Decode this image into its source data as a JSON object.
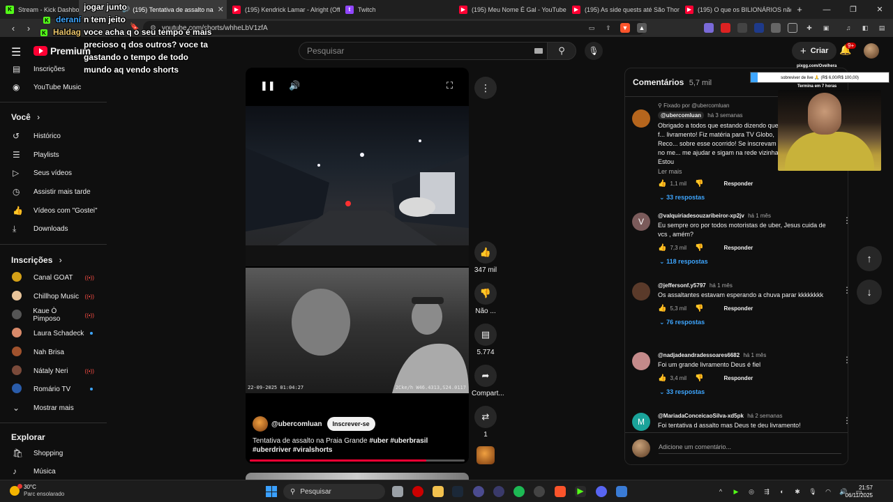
{
  "browser": {
    "tabs": [
      {
        "label": "Stream - Kick Dashboard",
        "favicon": "kick-icon",
        "active": false
      },
      {
        "label": "(195) Tentativa de assalto na",
        "favicon": "youtube-icon",
        "active": true
      },
      {
        "label": "(195) Kendrick Lamar - Alright (Offic",
        "favicon": "youtube-icon",
        "active": false
      },
      {
        "label": "Twitch",
        "favicon": "twitch-icon",
        "active": false
      },
      {
        "label": "(195) Meu Nome É Gal - YouTube",
        "favicon": "youtube-icon",
        "active": false
      },
      {
        "label": "(195) As side quests até São Thomé",
        "favicon": "youtube-icon",
        "active": false
      },
      {
        "label": "(195) O que os BILIONÁRIOS não te",
        "favicon": "youtube-icon",
        "active": false
      }
    ],
    "url": "youtube.com/shorts/whheLbV1zfA"
  },
  "youtube": {
    "logo_label": "Premium",
    "search_placeholder": "Pesquisar",
    "create_label": "Criar",
    "notifications_badge": "9+",
    "sidebar": {
      "top_items": [
        {
          "label": "Inscrições",
          "icon": "subscriptions-icon"
        },
        {
          "label": "YouTube Music",
          "icon": "youtube-music-icon"
        }
      ],
      "you_heading": "Você",
      "you_items": [
        {
          "label": "Histórico",
          "icon": "history-icon"
        },
        {
          "label": "Playlists",
          "icon": "playlists-icon"
        },
        {
          "label": "Seus vídeos",
          "icon": "your-videos-icon"
        },
        {
          "label": "Assistir mais tarde",
          "icon": "watch-later-icon"
        },
        {
          "label": "Vídeos com \"Gostei\"",
          "icon": "liked-icon"
        },
        {
          "label": "Downloads",
          "icon": "download-icon"
        }
      ],
      "subs_heading": "Inscrições",
      "subs_items": [
        {
          "label": "Canal GOAT",
          "live": true,
          "color": "#d4a017"
        },
        {
          "label": "Chillhop Music",
          "live": true,
          "color": "#e8c49a"
        },
        {
          "label": "Kaue Ò Pimposo",
          "live": true,
          "color": "#555555"
        },
        {
          "label": "Laura Schadeck",
          "live": false,
          "color": "#d98a6a"
        },
        {
          "label": "Nah Brisa",
          "live": false,
          "color": "#a0522d"
        },
        {
          "label": "Nátaly Neri",
          "live": true,
          "color": "#7a4a3a"
        },
        {
          "label": "Romário TV",
          "live": false,
          "color": "#2a5caa"
        }
      ],
      "show_more_label": "Mostrar mais",
      "explore_heading": "Explorar",
      "explore_items": [
        {
          "label": "Shopping",
          "icon": "shopping-icon"
        },
        {
          "label": "Música",
          "icon": "music-icon"
        }
      ]
    },
    "short": {
      "timestamp": "22-09-2025 01:04:27",
      "overlay_info": "2Cke/h W46.4313,S24.0117",
      "channel": "@ubercomluan",
      "subscribe_label": "Inscrever-se",
      "title_plain": "Tentativa de assalto na Praia Grande",
      "title_tags": "#uber #uberbrasil #uberdriver #viralshorts",
      "progress": 0.82
    },
    "actions": {
      "like_count": "347 mil",
      "dislike_label": "Não ...",
      "comments_count": "5.774",
      "share_label": "Compart...",
      "remix_count": "1"
    },
    "comments": {
      "heading": "Comentários",
      "count": "5,7 mil",
      "items": [
        {
          "pinned_label": "Fixado por @ubercomluan",
          "author": "@ubercomluan",
          "when": "há 3 semanas",
          "text": "Obrigado a todos que estando dizendo que f... livramento! Fiz matéria para TV Globo, Reco... sobre esse ocorrido! Se inscrevam no me... me ajudar e sigam na rede vizinha! Estou",
          "read_more": "Ler mais",
          "likes": "1,1 mil",
          "reply_label": "Responder",
          "replies": "33 respostas",
          "avatar_color": "#b5651d",
          "avatar_letter": ""
        },
        {
          "author": "@valquiriadesouzaribeiror-xp2jv",
          "when": "há 1 mês",
          "text": "Eu sempre oro por todos motoristas de uber, Jesus cuida de vcs , amém?",
          "likes": "7,3 mil",
          "reply_label": "Responder",
          "replies": "118 respostas",
          "avatar_color": "#7b5b5b",
          "avatar_letter": "V"
        },
        {
          "author": "@jeffersonf.y5797",
          "when": "há 1 mês",
          "text": "Os assaltantes estavam esperando a chuva parar kkkkkkkk",
          "likes": "5,3 mil",
          "reply_label": "Responder",
          "replies": "76 respostas",
          "avatar_color": "#5a3a2a",
          "avatar_letter": ""
        },
        {
          "author": "@nadjadeandradessoares6682",
          "when": "há 1 mês",
          "text": "Foi um grande livramento Deus é fiel",
          "likes": "3,4 mil",
          "reply_label": "Responder",
          "replies": "33 respostas",
          "avatar_color": "#c48a8a",
          "avatar_letter": ""
        },
        {
          "author": "@MariadaConceicaoSilva-xd5pk",
          "when": "há 2 semanas",
          "text": "Foi tentativa d assalto mas Deus te deu livramento!",
          "avatar_color": "#1aa39a",
          "avatar_letter": "M"
        }
      ],
      "add_placeholder": "Adicione um comentário..."
    }
  },
  "stream_overlay": {
    "chat": [
      {
        "user": "",
        "text": "jogar junto"
      },
      {
        "user": "deraní",
        "text": "n tem jeito"
      },
      {
        "user": "Haldag",
        "text": "voce acha q o seu tempo é mais"
      },
      {
        "user": "",
        "text": "precioso q dos outros? voce ta"
      },
      {
        "user": "",
        "text": "gastando o tempo de todo"
      },
      {
        "user": "",
        "text": "mundo aq vendo shorts"
      }
    ],
    "goal_url": "pixgg.com/Ovelhera",
    "goal_text": "sobreviver de live 🙏 (R$ 6,00/R$ 100,00)",
    "goal_ends": "Termina em 7 horas"
  },
  "taskbar": {
    "temperature": "30°C",
    "weather": "Parc ensolarado",
    "search_label": "Pesquisar",
    "time": "21:57",
    "date": "06/11/2025"
  }
}
